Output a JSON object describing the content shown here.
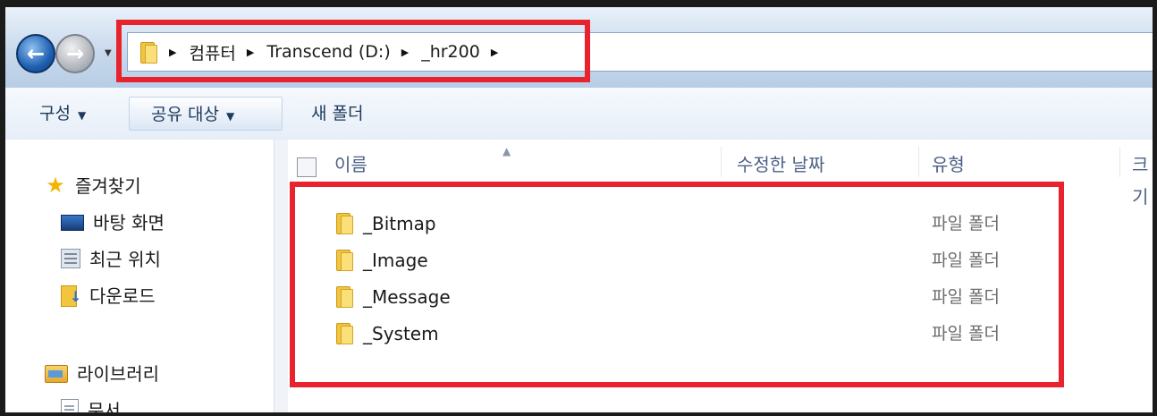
{
  "breadcrumb": {
    "segments": [
      "컴퓨터",
      "Transcend (D:)",
      "_hr200"
    ]
  },
  "toolbar": {
    "organize_label": "구성",
    "share_label": "공유 대상",
    "new_folder_label": "새 폴더"
  },
  "nav_pane": {
    "favorites_label": "즐겨찾기",
    "favorites": [
      {
        "label": "바탕 화면",
        "icon": "desktop-icon"
      },
      {
        "label": "최근 위치",
        "icon": "recent-places-icon"
      },
      {
        "label": "다운로드",
        "icon": "downloads-icon"
      }
    ],
    "libraries_label": "라이브러리",
    "libraries": [
      {
        "label": "문서",
        "icon": "documents-icon"
      }
    ]
  },
  "columns": {
    "name": "이름",
    "date_modified": "수정한 날짜",
    "type": "유형",
    "size": "크기"
  },
  "files": [
    {
      "name": "_Bitmap",
      "type": "파일 폴더"
    },
    {
      "name": "_Image",
      "type": "파일 폴더"
    },
    {
      "name": "_Message",
      "type": "파일 폴더"
    },
    {
      "name": "_System",
      "type": "파일 폴더"
    }
  ],
  "colors": {
    "highlight": "#e8232d",
    "folder": "#f2c53d"
  }
}
